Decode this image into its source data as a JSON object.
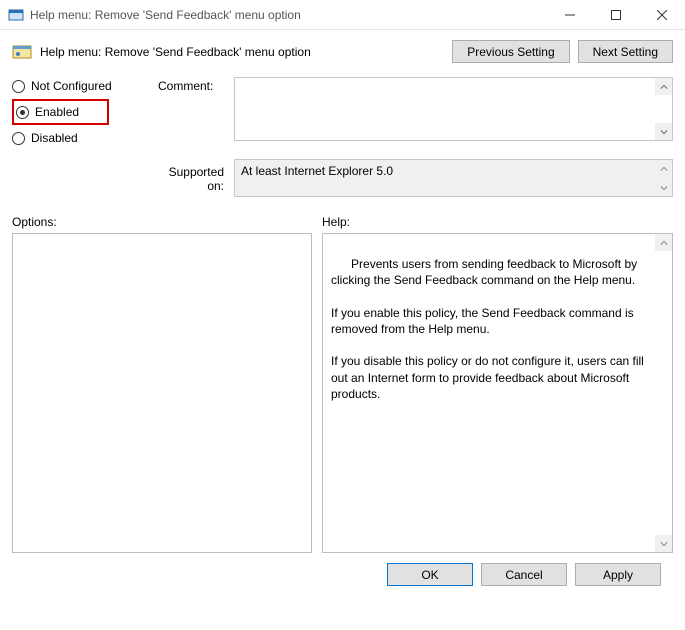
{
  "window": {
    "title": "Help menu: Remove 'Send Feedback' menu option"
  },
  "header": {
    "title": "Help menu: Remove 'Send Feedback' menu option",
    "prev_label": "Previous Setting",
    "next_label": "Next Setting"
  },
  "radios": {
    "not_configured": "Not Configured",
    "enabled": "Enabled",
    "disabled": "Disabled"
  },
  "labels": {
    "comment": "Comment:",
    "supported_on": "Supported on:",
    "options": "Options:",
    "help": "Help:"
  },
  "comment": "",
  "supported_on": "At least Internet Explorer 5.0",
  "help_text": "Prevents users from sending feedback to Microsoft by clicking the Send Feedback command on the Help menu.\n\nIf you enable this policy, the Send Feedback command is removed from the Help menu.\n\nIf you disable this policy or do not configure it, users can fill out an Internet form to provide feedback about Microsoft products.",
  "footer": {
    "ok": "OK",
    "cancel": "Cancel",
    "apply": "Apply"
  }
}
